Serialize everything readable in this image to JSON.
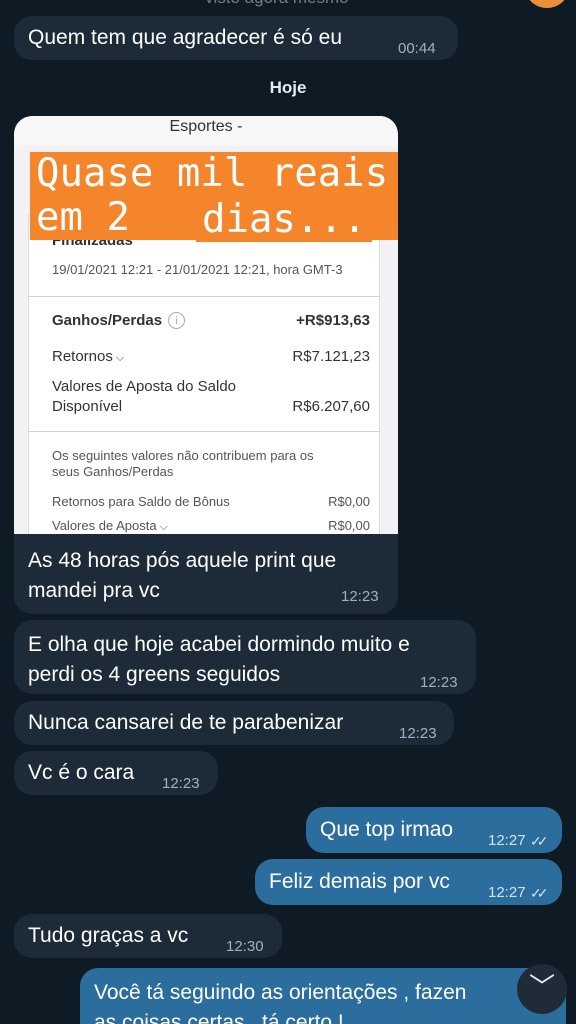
{
  "header": {
    "status": "visto agora mesmo"
  },
  "date_separator": "Hoje",
  "messages": [
    {
      "text": "Quem tem que agradecer é só eu",
      "time": "00:44"
    },
    {
      "caption": [
        "As 48 horas pós aquele print que",
        "mandei pra vc"
      ],
      "time": "12:23",
      "image": {
        "overlay_lines": [
          "Quase mil reais em 2",
          "dias..."
        ],
        "title": "Esportes -",
        "section": "Finalizadas",
        "period": "19/01/2021 12:21 - 21/01/2021 12:21, hora GMT-3",
        "gains_label": "Ganhos/Perdas",
        "gains_value": "+R$913,63",
        "returns_label": "Retornos",
        "returns_value": "R$7.121,23",
        "stakes_label_1": "Valores de Aposta do Saldo",
        "stakes_label_2": "Disponível",
        "stakes_value": "R$6.207,60",
        "note_1": "Os seguintes valores não contribuem para os",
        "note_2": "seus Ganhos/Perdas",
        "bonus_label": "Retornos para Saldo de Bônus",
        "bonus_value": "R$0,00",
        "bet_values_label": "Valores de Aposta",
        "bet_values_value": "R$0,00"
      }
    },
    {
      "lines": [
        "E olha que hoje acabei dormindo muito e",
        "perdi os 4 greens seguidos"
      ],
      "time": "12:23"
    },
    {
      "text": "Nunca cansarei de te parabenizar",
      "time": "12:23"
    },
    {
      "text": "Vc é o cara",
      "time": "12:23"
    },
    {
      "text": "Que top irmao",
      "time": "12:27",
      "ticks": "✓✓"
    },
    {
      "text": "Feliz demais por vc",
      "time": "12:27",
      "ticks": "✓✓"
    },
    {
      "text": "Tudo graças a vc",
      "time": "12:30"
    },
    {
      "lines": [
        "Você tá seguindo as orientações , fazen",
        "as coisas certas , tá certo !"
      ]
    }
  ],
  "scroll_down_icon": "chevron-down-icon",
  "colors": {
    "background": "#0e1a24",
    "incoming_bubble": "#1c2b37",
    "outgoing_bubble": "#2b6e9e",
    "overlay_highlight": "#f5852b"
  }
}
